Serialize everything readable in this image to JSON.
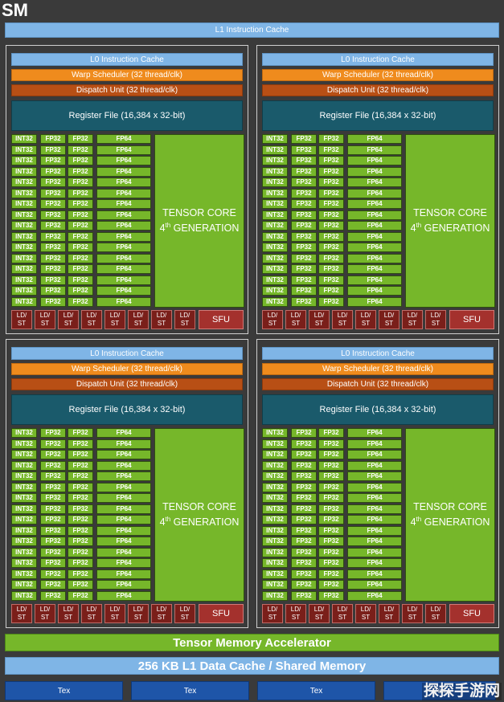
{
  "sm_title": "SM",
  "l1_instruction_cache": "L1 Instruction Cache",
  "partition": {
    "l0_cache": "L0 Instruction Cache",
    "warp_scheduler": "Warp Scheduler (32 thread/clk)",
    "dispatch_unit": "Dispatch Unit (32 thread/clk)",
    "register_file": "Register File (16,384 x 32-bit)",
    "int32": "INT32",
    "fp32": "FP32",
    "fp64": "FP64",
    "tensor_line1": "TENSOR CORE",
    "tensor_gen_num": "4",
    "tensor_gen_sup": "th",
    "tensor_gen_word": " GENERATION",
    "ld": "LD/",
    "st": "ST",
    "sfu": "SFU",
    "rows": 16,
    "ldst_units": 8
  },
  "tensor_memory_accelerator": "Tensor Memory Accelerator",
  "l1_data_cache": "256 KB L1 Data Cache / Shared Memory",
  "tex_label": "Tex",
  "tex_units": 4,
  "watermark": "探探手游网",
  "colors": {
    "background": "#3a3a3a",
    "green": "#76b72a",
    "light_blue": "#7fb5e6",
    "orange": "#ef8b1d",
    "dark_orange": "#b84f15",
    "teal": "#1a5a6b",
    "maroon": "#7a1f1a",
    "tex_blue": "#1e55a8"
  }
}
